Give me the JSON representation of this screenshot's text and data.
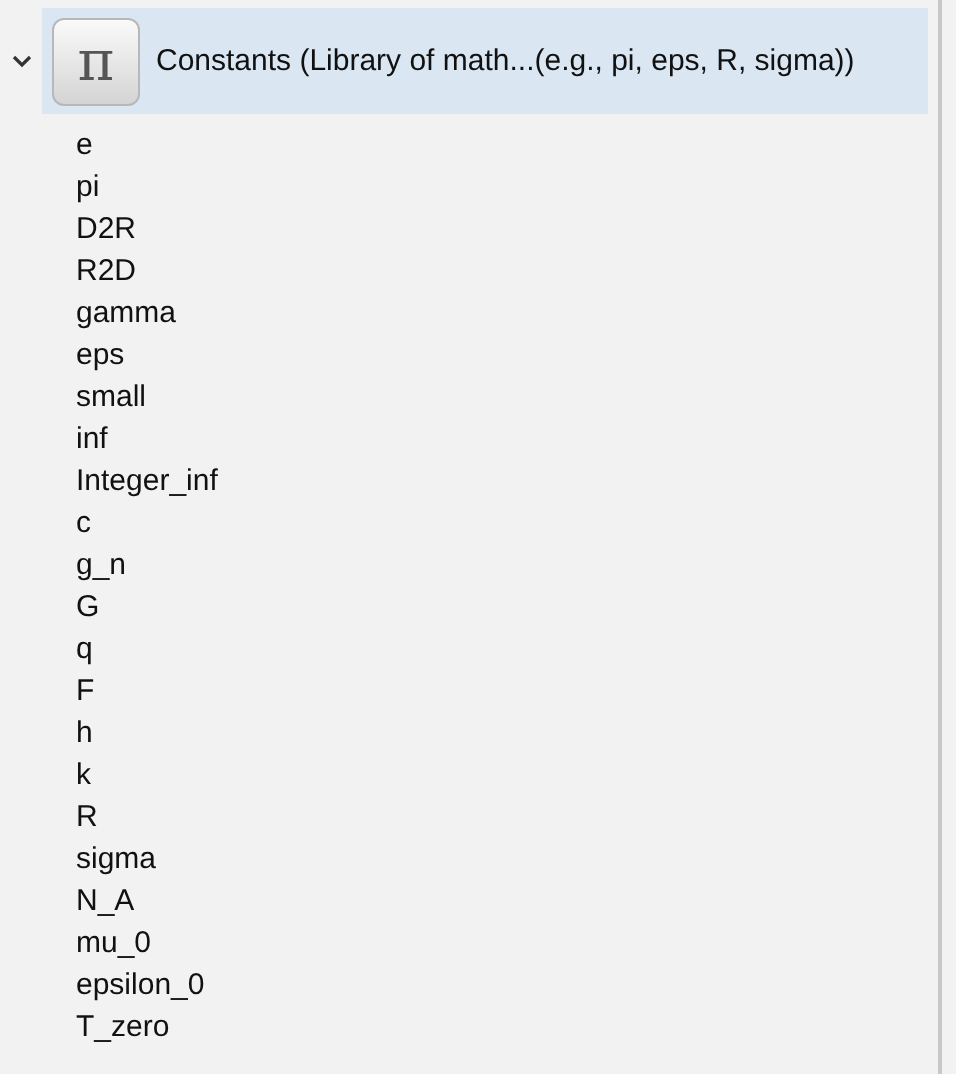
{
  "tree": {
    "expanded": true,
    "selected": true,
    "icon_glyph": "π",
    "label": "Constants (Library of math...(e.g., pi, eps, R, sigma))",
    "children": [
      {
        "label": "e"
      },
      {
        "label": "pi"
      },
      {
        "label": "D2R"
      },
      {
        "label": "R2D"
      },
      {
        "label": "gamma"
      },
      {
        "label": "eps"
      },
      {
        "label": "small"
      },
      {
        "label": "inf"
      },
      {
        "label": "Integer_inf"
      },
      {
        "label": "c"
      },
      {
        "label": "g_n"
      },
      {
        "label": "G"
      },
      {
        "label": "q"
      },
      {
        "label": "F"
      },
      {
        "label": "h"
      },
      {
        "label": "k"
      },
      {
        "label": "R"
      },
      {
        "label": "sigma"
      },
      {
        "label": "N_A"
      },
      {
        "label": "mu_0"
      },
      {
        "label": "epsilon_0"
      },
      {
        "label": "T_zero"
      }
    ]
  }
}
